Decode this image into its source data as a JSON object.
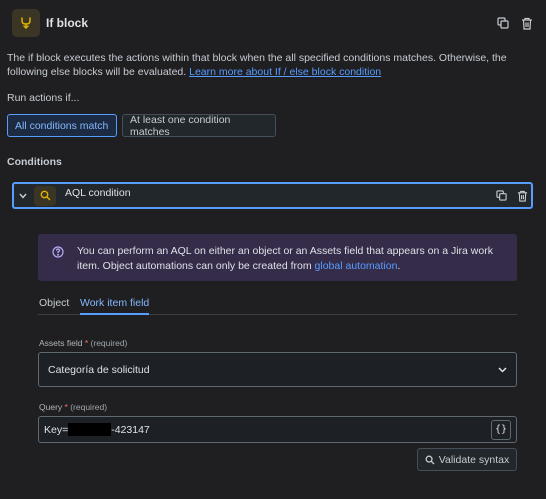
{
  "header": {
    "title": "If block",
    "icons": {
      "block": "branch-icon",
      "duplicate": "copy-icon",
      "delete": "trash-icon"
    }
  },
  "description": {
    "text": "The if block executes the actions within that block when the all specified conditions matches. Otherwise, the following else blocks will be evaluated.",
    "link": "Learn more about If / else block condition"
  },
  "run_actions": {
    "label": "Run actions if...",
    "options": [
      "All conditions match",
      "At least one condition matches"
    ],
    "selected": "All conditions match"
  },
  "conditions": {
    "label": "Conditions",
    "item": {
      "title": "AQL condition",
      "icon": "search-icon"
    }
  },
  "info": {
    "text": "You can perform an AQL on either an object or an Assets field that appears on a Jira work item. Object automations can only be created from",
    "link": "global automation",
    "suffix": "."
  },
  "tabs": {
    "object": "Object",
    "work_item_field": "Work item field",
    "active": "Work item field"
  },
  "assets_field": {
    "label": "Assets field",
    "required_mark": "*",
    "hint": "(required)",
    "value": "Categoría de solicitud"
  },
  "query": {
    "label": "Query",
    "required_mark": "*",
    "hint": "(required)",
    "prefix": "Key=",
    "suffix": "-423147",
    "braces": "{}"
  },
  "validate_button": "Validate syntax",
  "colors": {
    "accent": "#579dff",
    "icon_bg": "#3b3526",
    "info_bg": "#352c4a",
    "required": "#f87168"
  }
}
